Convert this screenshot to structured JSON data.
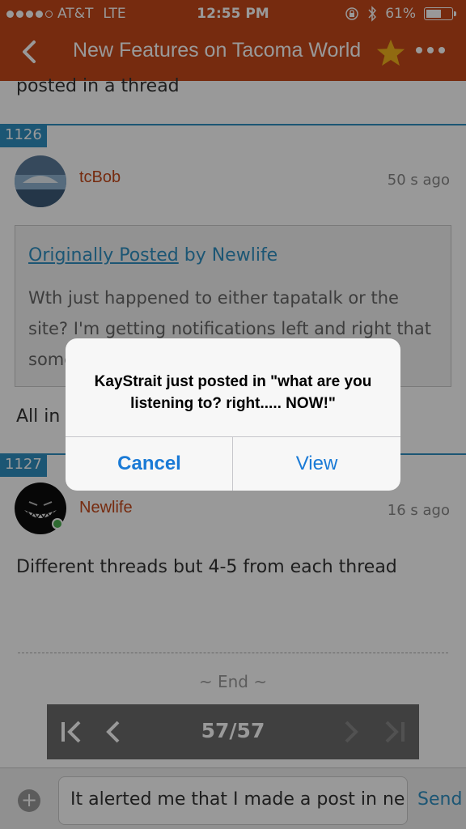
{
  "status_bar": {
    "carrier": "AT&T",
    "network": "LTE",
    "time": "12:55 PM",
    "battery": "61%",
    "battery_level": 0.61
  },
  "nav": {
    "title": "New Features on Tacoma World",
    "icons": [
      "back-chevron-icon",
      "star-icon",
      "more-icon"
    ]
  },
  "thread": {
    "partial_text": "posted in a thread",
    "posts": [
      {
        "number": "1126",
        "username": "tcBob",
        "time": "50 s ago",
        "quote": {
          "label": "Originally Posted",
          "by": "by Newlife",
          "text": "Wth just happened to either tapatalk or the site? I'm getting notifications left and right that some"
        },
        "body": "All in t"
      },
      {
        "number": "1127",
        "username": "Newlife",
        "time": "16 s ago",
        "body": "Different threads but 4-5 from each thread"
      }
    ],
    "end_text": "~ End ~"
  },
  "pager": {
    "count": "57/57"
  },
  "compose": {
    "input_value": "It alerted me that I made a post in ne",
    "send_label": "Send",
    "plus_label": "+"
  },
  "alert": {
    "message": "KayStrait just posted in \"what are you listening to? right..... NOW!\"",
    "cancel_label": "Cancel",
    "view_label": "View"
  },
  "colors": {
    "brand": "#c5481a",
    "accent": "#2f8fc2",
    "alert_button": "#1a7ad6"
  }
}
